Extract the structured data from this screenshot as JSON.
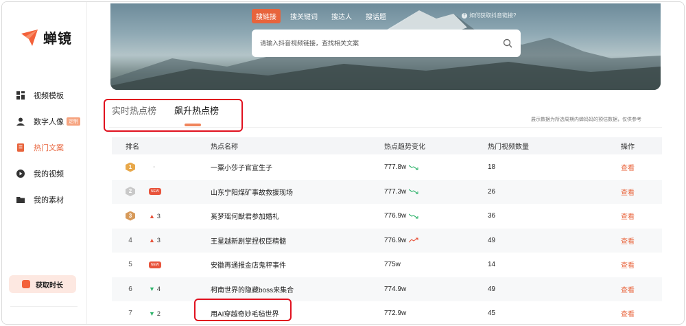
{
  "brand": {
    "name": "蝉镜",
    "accent": "#e8643c"
  },
  "sidebar": {
    "items": [
      {
        "label": "视频模板",
        "icon": "template-grid-icon",
        "active": false
      },
      {
        "label": "数字人像",
        "icon": "person-icon",
        "badge": "定制",
        "active": false
      },
      {
        "label": "热门文案",
        "icon": "document-icon",
        "active": true
      },
      {
        "label": "我的视频",
        "icon": "play-circle-icon",
        "active": false
      },
      {
        "label": "我的素材",
        "icon": "folder-icon",
        "active": false
      }
    ],
    "gain_button": "获取时长"
  },
  "search": {
    "tabs": [
      "搜链接",
      "搜关键词",
      "搜达人",
      "搜话题"
    ],
    "active_tab": "搜链接",
    "help_link": "如何获取抖音链接?",
    "placeholder": "请输入抖音视频链接，查找相关文案"
  },
  "rank_tabs": [
    "实时热点榜",
    "飙升热点榜"
  ],
  "active_rank_tab": "飙升热点榜",
  "disclaimer": "展示数据为所选周期内蝉妈妈的预估数据，仅供参考",
  "table": {
    "headers": {
      "rank": "排名",
      "name": "热点名称",
      "trend": "热点趋势变化",
      "count": "热门视频数量",
      "op": "操作"
    },
    "rows": [
      {
        "rank": "1",
        "medal": "gold",
        "change": "-",
        "change_dir": "flat",
        "name": "一粟小莎子官宣生子",
        "heat": "777.8w",
        "trend": "down",
        "count": "18",
        "op": "查看"
      },
      {
        "rank": "2",
        "medal": "silver",
        "change": "NEW",
        "change_dir": "new",
        "name": "山东宁阳煤矿事故救援现场",
        "heat": "777.3w",
        "trend": "down",
        "count": "26",
        "op": "查看"
      },
      {
        "rank": "3",
        "medal": "bronze",
        "change": "3",
        "change_dir": "up",
        "name": "奚梦瑶何猷君参加婚礼",
        "heat": "776.9w",
        "trend": "down",
        "count": "36",
        "op": "查看"
      },
      {
        "rank": "4",
        "medal": "",
        "change": "3",
        "change_dir": "up",
        "name": "王星越新剧掌捏权臣精髓",
        "heat": "776.9w",
        "trend": "up",
        "count": "49",
        "op": "查看"
      },
      {
        "rank": "5",
        "medal": "",
        "change": "NEW",
        "change_dir": "new",
        "name": "安徽再通报金店鬼秤事件",
        "heat": "775w",
        "trend": "none",
        "count": "14",
        "op": "查看"
      },
      {
        "rank": "6",
        "medal": "",
        "change": "4",
        "change_dir": "down",
        "name": "柯南世界的隐藏boss来集合",
        "heat": "774.9w",
        "trend": "none",
        "count": "49",
        "op": "查看"
      },
      {
        "rank": "7",
        "medal": "",
        "change": "2",
        "change_dir": "down",
        "name": "用AI穿越奇妙毛毡世界",
        "heat": "772.9w",
        "trend": "none",
        "count": "45",
        "op": "查看"
      }
    ]
  }
}
